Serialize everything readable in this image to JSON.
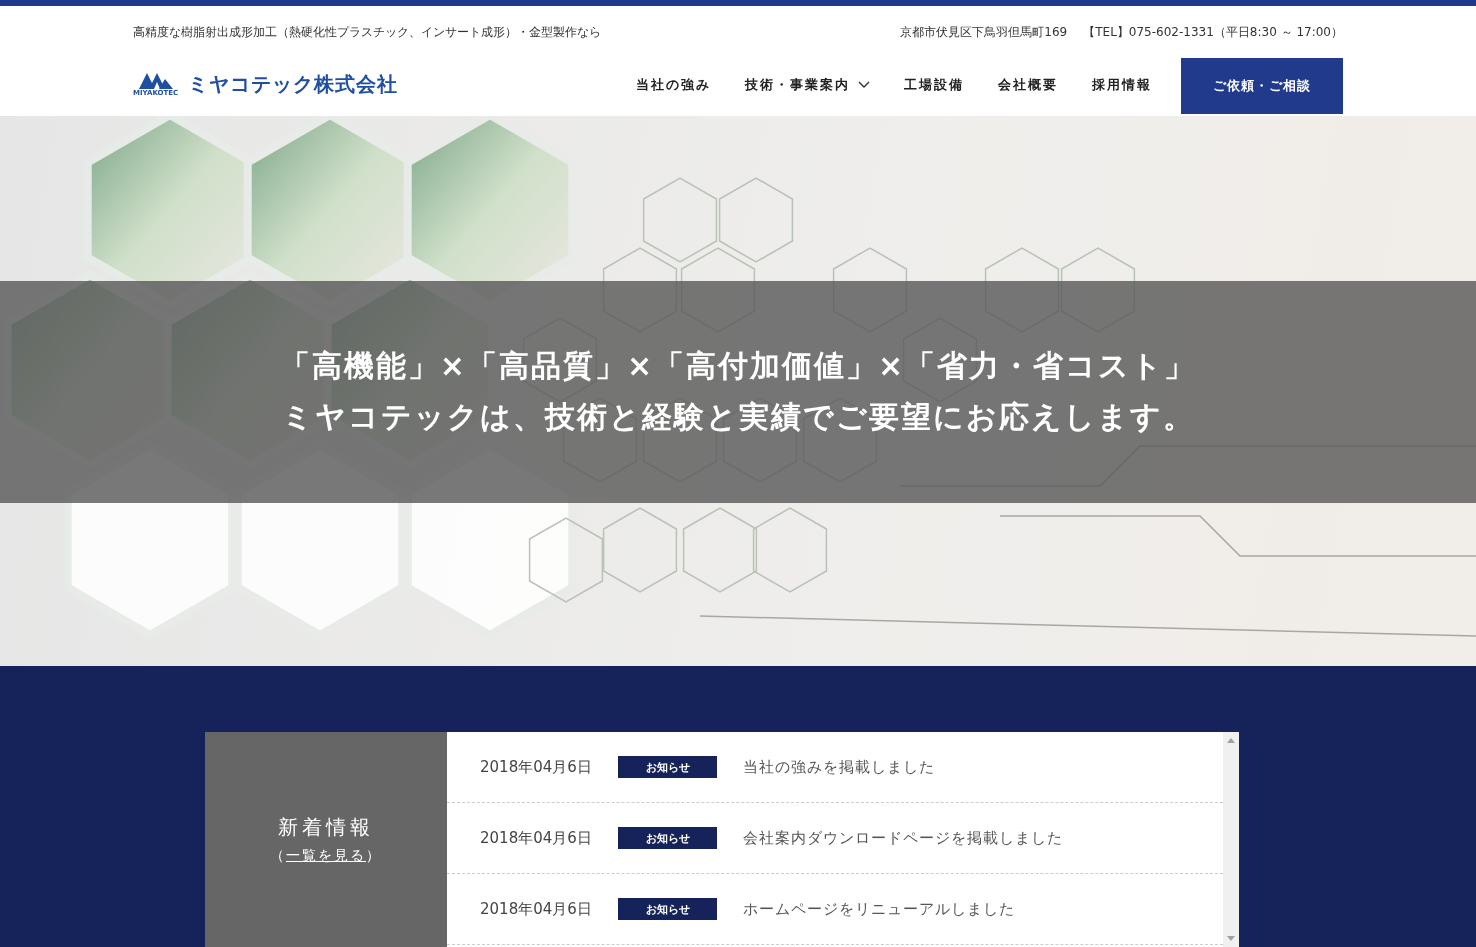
{
  "header": {
    "tagline": "高精度な樹脂射出成形加工（熱硬化性プラスチック、インサート成形）・金型製作なら",
    "address": "京都市伏見区下鳥羽但馬町169",
    "tel": "【TEL】075-602-1331（平日8:30 ～ 17:00）",
    "logo": {
      "mark_text": "MIYAKOTEC",
      "name": "ミヤコテック株式会社"
    },
    "nav": [
      {
        "label": "当社の強み",
        "kind": "link"
      },
      {
        "label": "技術・事業案内",
        "kind": "dropdown"
      },
      {
        "label": "工場設備",
        "kind": "link"
      },
      {
        "label": "会社概要",
        "kind": "link"
      },
      {
        "label": "採用情報",
        "kind": "link"
      }
    ],
    "cta": "ご依頼・ご相談"
  },
  "hero": {
    "lines": [
      "「高機能」×「高品質」×「高付加価値」×「省力・省コスト」",
      "ミヤコテックは、技術と経験と実績でご要望にお応えします。"
    ]
  },
  "news": {
    "heading": "新着情報",
    "list_link": {
      "open": "（",
      "label": "一覧を見る",
      "close": "）"
    },
    "items": [
      {
        "date": "2018年04月6日",
        "tag": "お知らせ",
        "title": "当社の強みを掲載しました"
      },
      {
        "date": "2018年04月6日",
        "tag": "お知らせ",
        "title": "会社案内ダウンロードページを掲載しました"
      },
      {
        "date": "2018年04月6日",
        "tag": "お知らせ",
        "title": "ホームページをリニューアルしました"
      }
    ]
  }
}
